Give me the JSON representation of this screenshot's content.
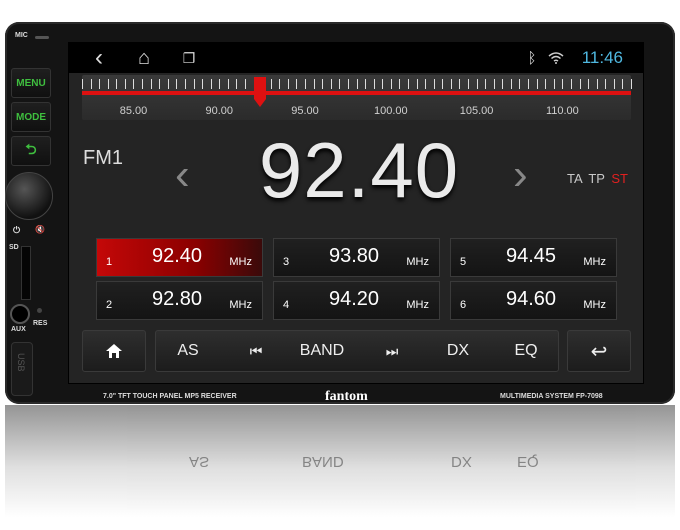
{
  "device": {
    "left_labels": {
      "mic": "MIC",
      "sd": "SD",
      "aux": "AUX",
      "res": "RES",
      "usb": "USB"
    },
    "buttons": {
      "menu": "MENU",
      "mode": "MODE",
      "back": "⮌"
    },
    "power_icon": "⏻",
    "mute_icon": "🔇",
    "caption_left": "7.0\" TFT TOUCH PANEL MP5 RECEIVER",
    "brand": "fantom",
    "caption_right": "MULTIMEDIA SYSTEM FP-7098"
  },
  "statusbar": {
    "back_icon": "‹",
    "home_icon": "⌂",
    "recents_icon": "❐",
    "bluetooth_icon": "ᛒ",
    "wifi_icon": "wifi",
    "time": "11:46"
  },
  "tuner": {
    "scale": [
      "85.00",
      "90.00",
      "95.00",
      "100.00",
      "105.00",
      "110.00"
    ],
    "current_frequency": 92.4,
    "range": [
      82.0,
      114.0
    ]
  },
  "radio": {
    "band": "FM1",
    "frequency": "92.40",
    "prev_icon": "‹",
    "next_icon": "›",
    "flag_ta": "TA",
    "flag_tp": "TP",
    "flag_st": "ST"
  },
  "presets": [
    {
      "num": "1",
      "freq": "92.40",
      "unit": "MHz",
      "active": true
    },
    {
      "num": "2",
      "freq": "92.80",
      "unit": "MHz",
      "active": false
    },
    {
      "num": "3",
      "freq": "93.80",
      "unit": "MHz",
      "active": false
    },
    {
      "num": "4",
      "freq": "94.20",
      "unit": "MHz",
      "active": false
    },
    {
      "num": "5",
      "freq": "94.45",
      "unit": "MHz",
      "active": false
    },
    {
      "num": "6",
      "freq": "94.60",
      "unit": "MHz",
      "active": false
    }
  ],
  "bottom_bar": {
    "home_icon": "home",
    "as": "AS",
    "prev_icon": "⏮",
    "band": "BAND",
    "next_icon": "⏭",
    "dx": "DX",
    "eq": "EQ",
    "return_icon": "↩"
  },
  "colors": {
    "accent_red": "#d11111",
    "clock_blue": "#4fb8e0",
    "side_green": "#3fbf3f"
  }
}
